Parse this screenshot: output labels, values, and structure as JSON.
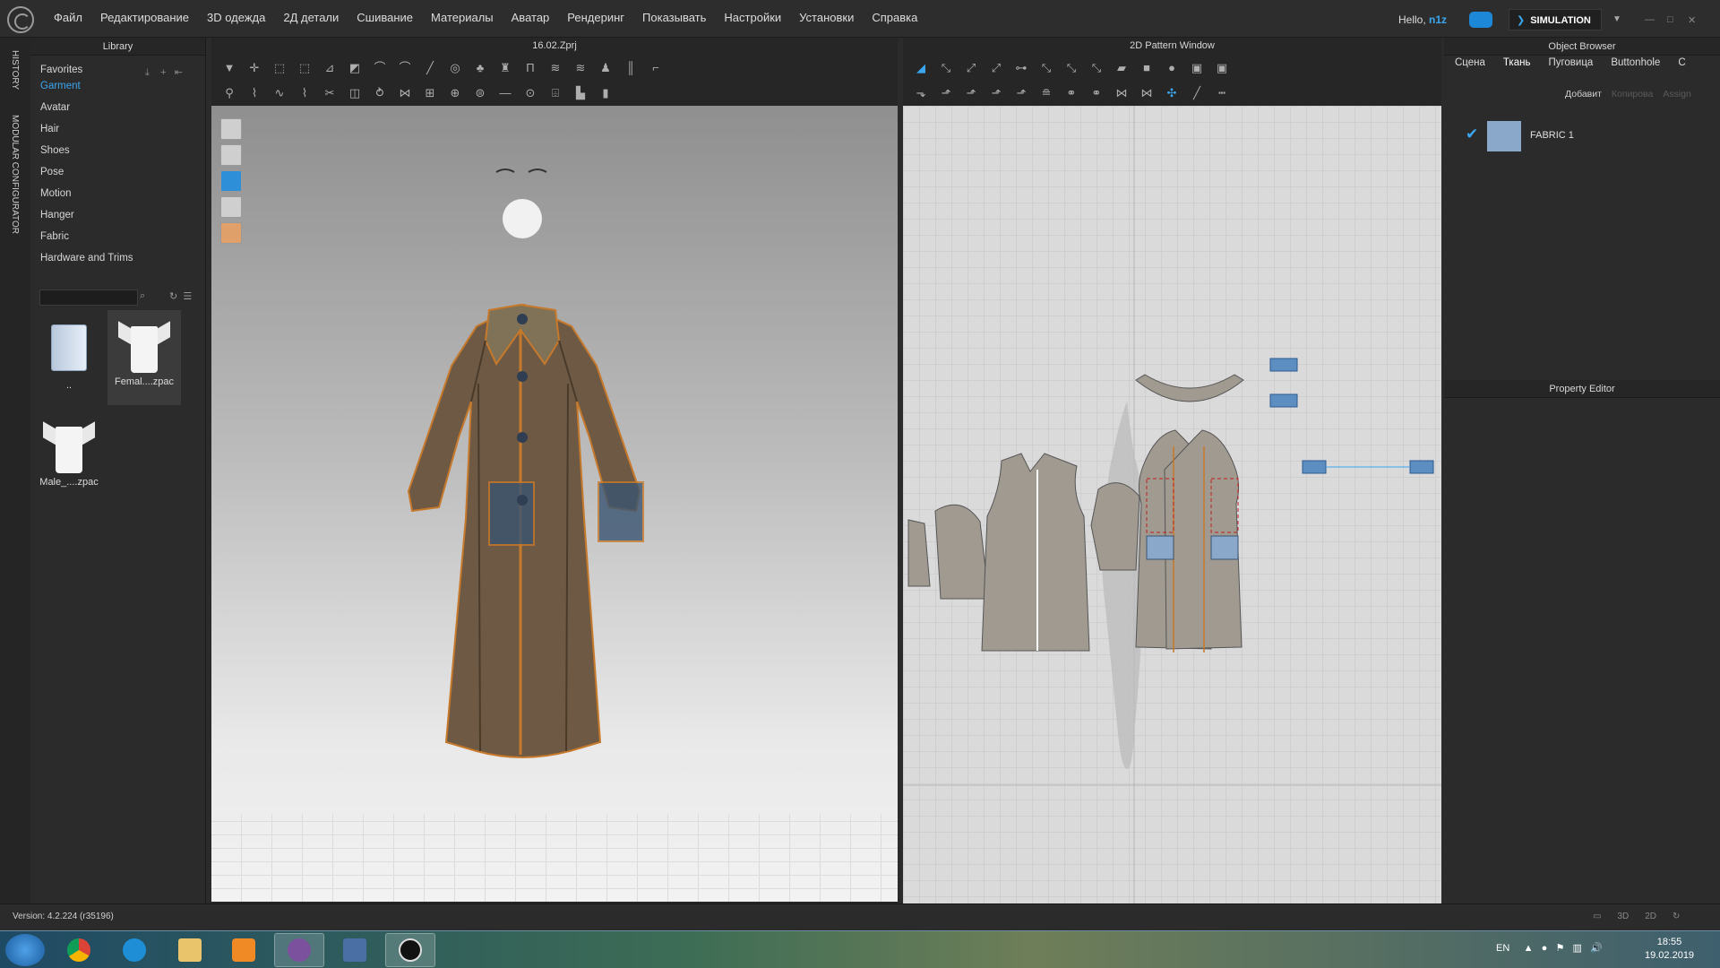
{
  "menu": [
    "Файл",
    "Редактирование",
    "3D одежда",
    "2Д детали",
    "Сшивание",
    "Материалы",
    "Аватар",
    "Рендеринг",
    "Показывать",
    "Настройки",
    "Установки",
    "Справка"
  ],
  "user": {
    "greeting": "Hello,",
    "name": "n1z"
  },
  "mode": "SIMULATION",
  "side_tabs": [
    "HISTORY",
    "MODULAR CONFIGURATOR"
  ],
  "library": {
    "title": "Library",
    "items": [
      "Favorites",
      "Garment",
      "Avatar",
      "Hair",
      "Shoes",
      "Pose",
      "Motion",
      "Hanger",
      "Fabric",
      "Hardware and Trims"
    ],
    "active_item": "Garment",
    "files": [
      {
        "label": ".."
      },
      {
        "label": "Femal....zpac"
      },
      {
        "label": "Male_....zpac"
      }
    ]
  },
  "viewport3d": {
    "title": "16.02.Zprj"
  },
  "pattern_window": {
    "title": "2D Pattern Window"
  },
  "object_browser": {
    "title": "Object Browser",
    "tabs": [
      "Сцена",
      "Ткань",
      "Пуговица",
      "Buttonhole",
      "С"
    ],
    "active_tab": "Ткань",
    "add_label": "Добавит",
    "copy_label": "Копирова",
    "assign_label": "Assign",
    "fabrics": [
      {
        "name": "FABRIC 1",
        "color": "#8aa8c9"
      }
    ]
  },
  "property_editor": {
    "title": "Property Editor"
  },
  "status": {
    "version": "Version: 4.2.224 (r35196)"
  },
  "taskbar": {
    "lang": "EN",
    "time": "18:55",
    "date": "19.02.2019"
  },
  "colors": {
    "accent": "#3ba7f0",
    "coat": "#6e5a44",
    "stitch": "#c7792b",
    "pattern_piece": "#a09a91"
  }
}
